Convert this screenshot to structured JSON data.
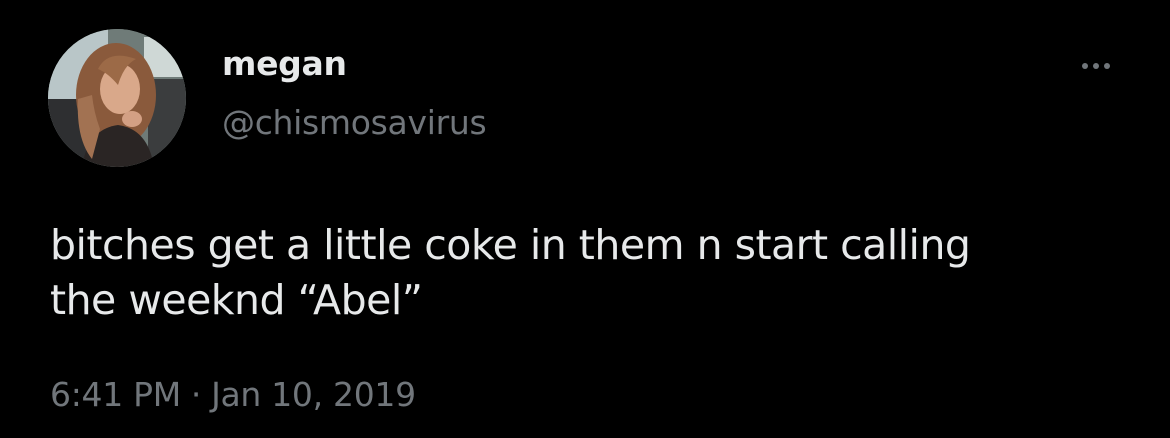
{
  "tweet": {
    "author": {
      "display_name": "megan",
      "handle": "@chismosavirus",
      "avatar_icon": "profile-photo"
    },
    "more_icon": "more-horizontal-icon",
    "text": "bitches get a little coke in them n start calling\nthe weeknd “Abel”",
    "time": "6:41 PM",
    "separator": "·",
    "date": "Jan 10, 2019"
  },
  "colors": {
    "background": "#000000",
    "primary_text": "#e7e9ea",
    "secondary_text": "#71767b"
  }
}
